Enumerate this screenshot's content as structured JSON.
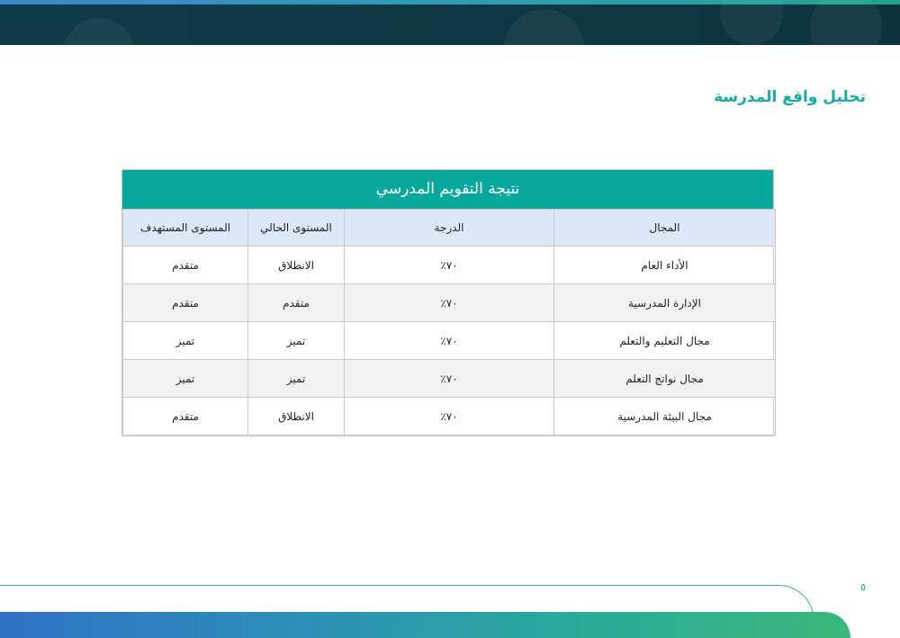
{
  "header": {
    "section_title": "تحليل واقع المدرسة"
  },
  "table": {
    "title": "نتيجة التقويم المدرسي",
    "columns": [
      "المجال",
      "الدرجة",
      "المستوى الحالي",
      "المستوى المستهدف"
    ],
    "rows": [
      [
        "الأداء العام",
        "٧٠٪",
        "الانطلاق",
        "متقدم"
      ],
      [
        "الإدارة المدرسية",
        "٧٠٪",
        "متقدم",
        "متقدم"
      ],
      [
        "مجال التعليم والتعلم",
        "٧٠٪",
        "تميز",
        "تميز"
      ],
      [
        "مجال نواتج التعلم",
        "٧٠٪",
        "تميز",
        "تميز"
      ],
      [
        "مجال البيئة المدرسية",
        "٧٠٪",
        "الانطلاق",
        "متقدم"
      ]
    ]
  },
  "footer": {
    "page_number": "٥"
  },
  "colors": {
    "header_bg": "#0f3a48",
    "title_color": "#1aa9a5",
    "table_header_bg": "#09a89d",
    "column_header_bg": "#dce8f5"
  }
}
